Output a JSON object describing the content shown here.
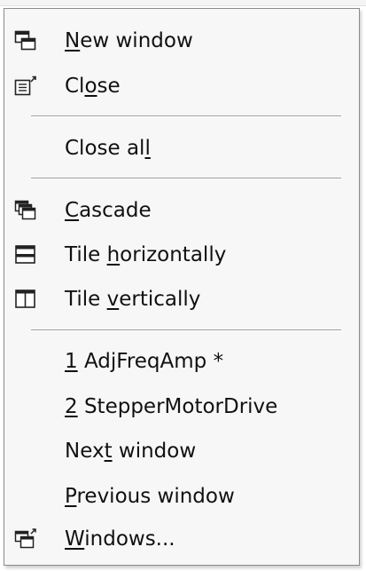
{
  "menu": {
    "items": {
      "new_window": {
        "pre": "",
        "key": "N",
        "post": "ew window",
        "icon": "new-window-icon"
      },
      "close": {
        "pre": "Cl",
        "key": "o",
        "post": "se",
        "icon": "close-window-icon"
      },
      "close_all": {
        "pre": "Close al",
        "key": "l",
        "post": ""
      },
      "cascade": {
        "pre": "",
        "key": "C",
        "post": "ascade",
        "icon": "cascade-icon"
      },
      "tile_horizontally": {
        "pre": "Tile ",
        "key": "h",
        "post": "orizontally",
        "icon": "tile-horizontal-icon"
      },
      "tile_vertically": {
        "pre": "Tile ",
        "key": "v",
        "post": "ertically",
        "icon": "tile-vertical-icon"
      },
      "window_1": {
        "pre": "",
        "key": "1",
        "post": " AdjFreqAmp *"
      },
      "window_2": {
        "pre": "",
        "key": "2",
        "post": " StepperMotorDrive"
      },
      "next_window": {
        "pre": "Nex",
        "key": "t",
        "post": " window"
      },
      "previous_window": {
        "pre": "",
        "key": "P",
        "post": "revious window"
      },
      "windows": {
        "pre": "",
        "key": "W",
        "post": "indows...",
        "icon": "windows-list-icon"
      }
    }
  }
}
